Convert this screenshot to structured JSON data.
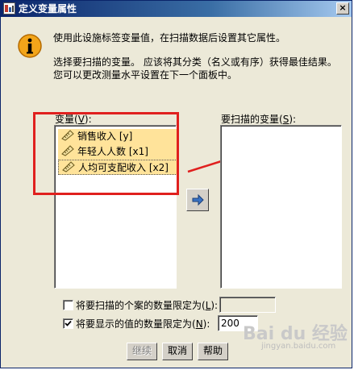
{
  "window": {
    "title": "定义变量属性",
    "close_glyph": "×"
  },
  "description": {
    "line1": "使用此设施标签变量值，在扫描数据后设置其它属性。",
    "line2": "选择要扫描的变量。 应该将其分类（名义或有序）获得最佳结果。",
    "line3": "您可以更改测量水平设置在下一个面板中。"
  },
  "source_list": {
    "label": "变量(",
    "label_key": "V",
    "label_end": "):",
    "items": [
      {
        "label": "销售收入 [y]"
      },
      {
        "label": "年轻人人数 [x1]"
      },
      {
        "label": "人均可支配收入 [x2]"
      }
    ]
  },
  "target_list": {
    "label": "要扫描的变量(",
    "label_key": "S",
    "label_end": "):"
  },
  "limit_cases": {
    "label": "将要扫描的个案的数量限定为(",
    "label_key": "L",
    "label_end": "):",
    "checked": false,
    "value": ""
  },
  "limit_values": {
    "label": "将要显示的值的数量限定为(",
    "label_key": "N",
    "label_end": "):",
    "checked": true,
    "value": "200"
  },
  "buttons": {
    "continue": "继续",
    "cancel": "取消",
    "help": "帮助"
  },
  "watermark": {
    "text": "Bai du 经验",
    "sub": "jingyan.baidu.com"
  },
  "colors": {
    "accent": "#e0201e",
    "selection": "#ffe39a"
  }
}
